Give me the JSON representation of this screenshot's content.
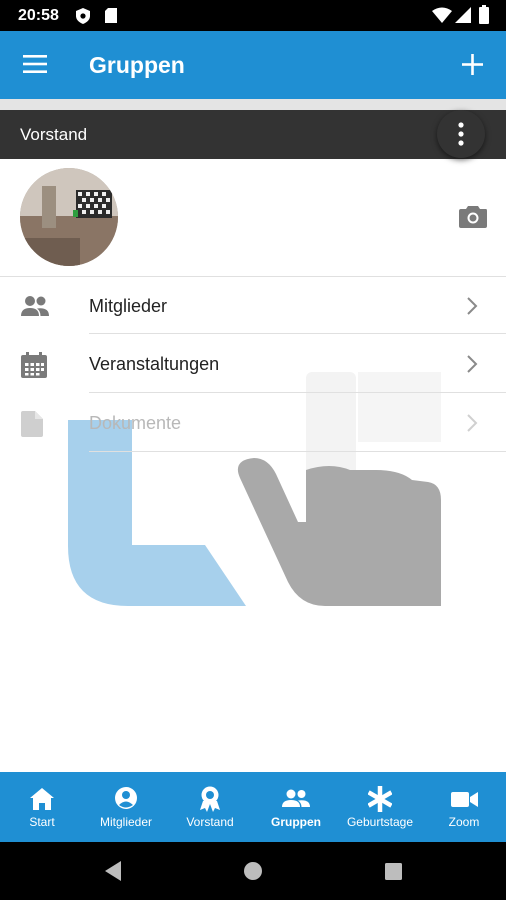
{
  "status_bar": {
    "time": "20:58"
  },
  "app_bar": {
    "title": "Gruppen",
    "menu_icon": "hamburger-menu-icon",
    "add_icon": "plus-icon"
  },
  "section": {
    "title": "Vorstand",
    "menu_icon": "more-vertical-icon"
  },
  "group": {
    "camera_icon": "camera-icon"
  },
  "menu": [
    {
      "label": "Mitglieder",
      "icon": "people-icon",
      "enabled": true
    },
    {
      "label": "Veranstaltungen",
      "icon": "calendar-icon",
      "enabled": true
    },
    {
      "label": "Dokumente",
      "icon": "document-icon",
      "enabled": false
    }
  ],
  "bottom_nav": [
    {
      "label": "Start",
      "icon": "home-icon",
      "active": false
    },
    {
      "label": "Mitglieder",
      "icon": "account-circle-icon",
      "active": false
    },
    {
      "label": "Vorstand",
      "icon": "award-badge-icon",
      "active": false
    },
    {
      "label": "Gruppen",
      "icon": "group-icon",
      "active": true
    },
    {
      "label": "Geburtstage",
      "icon": "asterisk-icon",
      "active": false
    },
    {
      "label": "Zoom",
      "icon": "video-camera-icon",
      "active": false
    }
  ],
  "colors": {
    "primary": "#1f8fd3",
    "section_bar": "#333333",
    "disabled_text": "#b8b8b8"
  }
}
